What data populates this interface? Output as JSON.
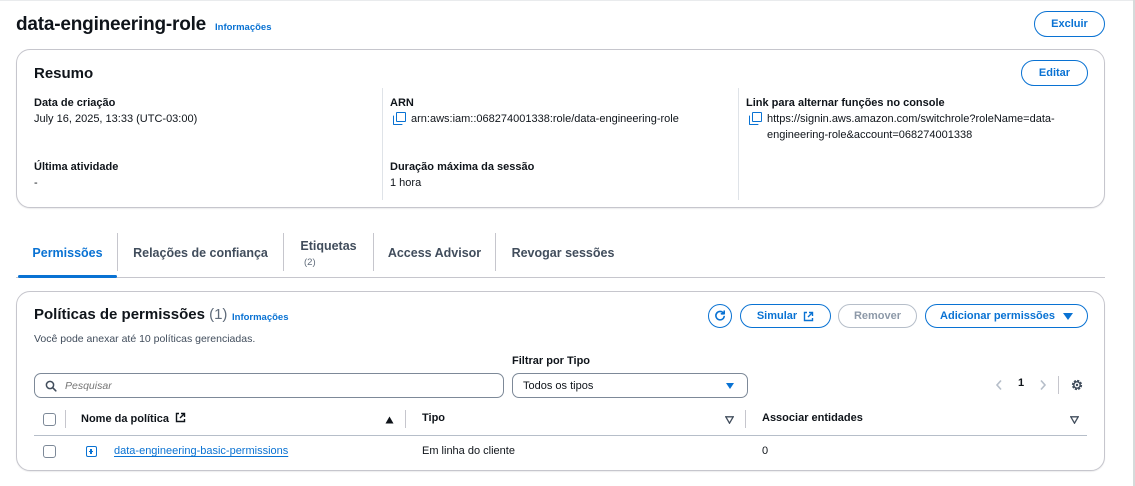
{
  "header": {
    "title": "data-engineering-role",
    "info_link": "Informações",
    "delete_button": "Excluir"
  },
  "summary": {
    "title": "Resumo",
    "edit_button": "Editar",
    "creation_date_label": "Data de criação",
    "creation_date_value": "July 16, 2025, 13:33 (UTC-03:00)",
    "last_activity_label": "Última atividade",
    "last_activity_value": "-",
    "arn_label": "ARN",
    "arn_value": "arn:aws:iam::068274001338:role/data-engineering-role",
    "max_session_label": "Duração máxima da sessão",
    "max_session_value": "1 hora",
    "switch_link_label": "Link para alternar funções no console",
    "switch_link_line1": "https://signin.aws.amazon.com/switchrole?roleName=data-",
    "switch_link_line2": "engineering-role&account=068274001338"
  },
  "tabs": [
    {
      "label": "Permissões",
      "active": true
    },
    {
      "label": "Relações de confiança"
    },
    {
      "label": "Etiquetas",
      "count": "(2)"
    },
    {
      "label": "Access Advisor"
    },
    {
      "label": "Revogar sessões"
    }
  ],
  "permissions": {
    "title": "Políticas de permissões",
    "count": "(1)",
    "info_link": "Informações",
    "description": "Você pode anexar até 10 políticas gerenciadas.",
    "simulate_button": "Simular",
    "remove_button": "Remover",
    "add_button": "Adicionar permissões",
    "search_placeholder": "Pesquisar",
    "filter_label": "Filtrar por Tipo",
    "filter_value": "Todos os tipos",
    "page_number": "1",
    "columns": [
      "Nome da política",
      "Tipo",
      "Associar entidades"
    ],
    "rows": [
      {
        "name": "data-engineering-basic-permissions",
        "type": "Em linha do cliente",
        "entities": "0"
      }
    ]
  },
  "colors": {
    "accent": "#0972d3",
    "text": "#0f141a",
    "border": "#c6c6cd"
  }
}
